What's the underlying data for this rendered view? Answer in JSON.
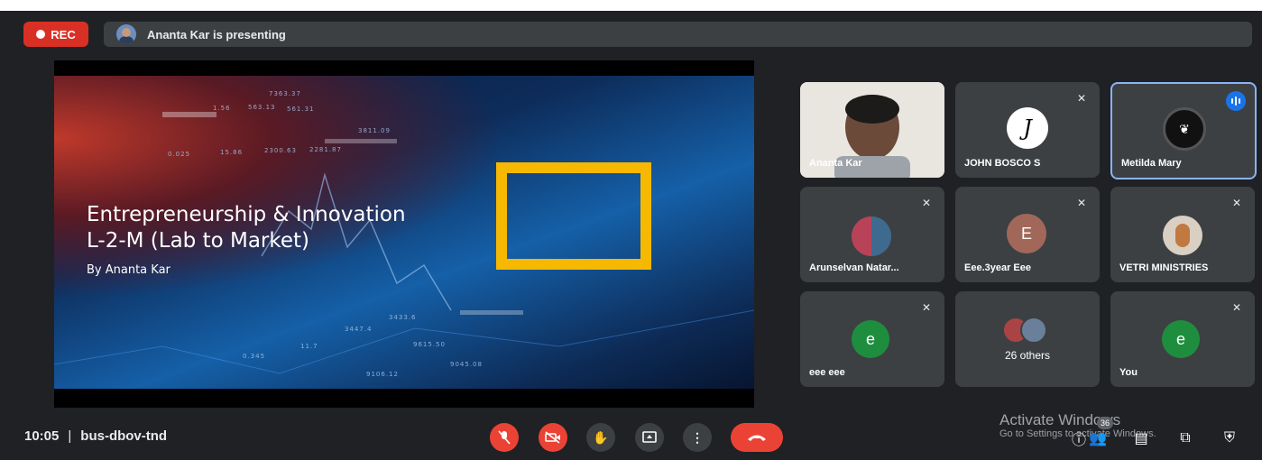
{
  "recording": {
    "label": "REC"
  },
  "presenter_banner": {
    "text": "Ananta Kar is presenting"
  },
  "slide": {
    "title_line1": "Entrepreneurship & Innovation",
    "title_line2": "L-2-M (Lab to Market)",
    "byline": "By Ananta Kar",
    "tickers": [
      "7363.37",
      "563.13",
      "561.31",
      "3811.09",
      "2300.63",
      "2281.87",
      "3447.4",
      "3433.6",
      "9615.50",
      "9045.08",
      "9106.12",
      "0.345",
      "11.7",
      "15.86",
      "1.56",
      "0.025"
    ]
  },
  "participants": [
    {
      "name": "Ananta Kar",
      "type": "video",
      "muted": false
    },
    {
      "name": "JOHN BOSCO S",
      "type": "avatar-logo",
      "muted": true
    },
    {
      "name": "Metilda Mary",
      "type": "avatar-logo",
      "muted": false,
      "speaking": true
    },
    {
      "name": "Arunselvan Natar...",
      "type": "avatar-photo",
      "muted": true
    },
    {
      "name": "Eee.3year Eee",
      "type": "initial",
      "initial": "E",
      "color": "#a1685a",
      "muted": true
    },
    {
      "name": "VETRI MINISTRIES",
      "type": "avatar-photo",
      "muted": true
    },
    {
      "name": "eee eee",
      "type": "initial",
      "initial": "e",
      "color": "#1e8e3e",
      "muted": true
    },
    {
      "name": "26 others",
      "type": "group",
      "muted": false
    },
    {
      "name": "You",
      "type": "initial",
      "initial": "e",
      "color": "#1e8e3e",
      "muted": true
    }
  ],
  "meeting": {
    "time": "10:05",
    "separator": "|",
    "code": "bus-dbov-tnd"
  },
  "controls": [
    "mic-off",
    "camera-off",
    "raise-hand",
    "present",
    "more-options",
    "leave-call"
  ],
  "watermark": {
    "line1": "Activate Windows",
    "line2": "Go to Settings to activate Windows."
  },
  "right_controls": {
    "people_count": "36"
  },
  "colors": {
    "rec": "#d93025",
    "end_call": "#ea4335",
    "speaking_ring": "#8ab4f8",
    "slide_accent": "#f6b800"
  }
}
